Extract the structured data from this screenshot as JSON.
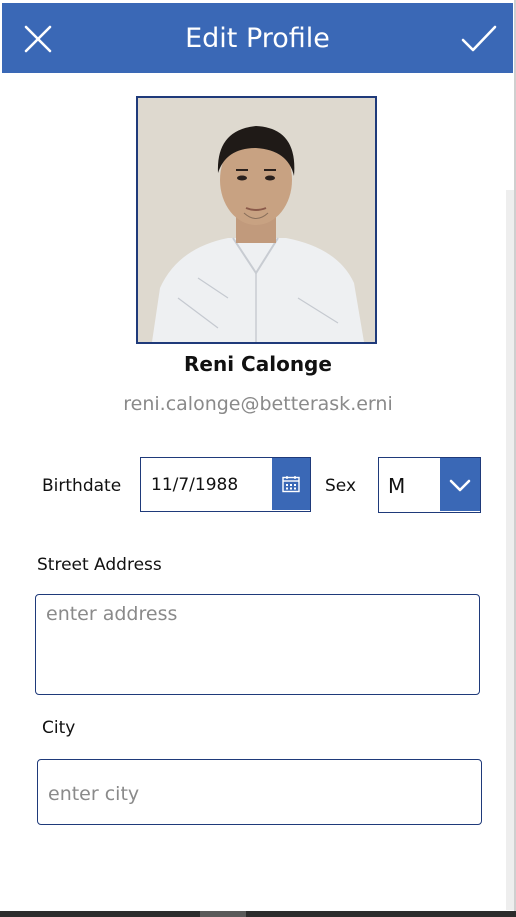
{
  "header": {
    "title": "Edit Profile",
    "close_icon": "close-icon",
    "confirm_icon": "check-icon"
  },
  "profile": {
    "name": "Reni Calonge",
    "email": "reni.calonge@betterask.erni"
  },
  "form": {
    "birthdate_label": "Birthdate",
    "birthdate_value": "11/7/1988",
    "calendar_icon": "calendar-icon",
    "sex_label": "Sex",
    "sex_value": "M",
    "sex_dropdown_icon": "chevron-down-icon",
    "street_label": "Street Address",
    "street_placeholder": "enter address",
    "city_label": "City",
    "city_placeholder": "enter city"
  },
  "colors": {
    "accent": "#3a68b6",
    "border": "#1f3a7a",
    "placeholder": "#8a8a8a"
  }
}
